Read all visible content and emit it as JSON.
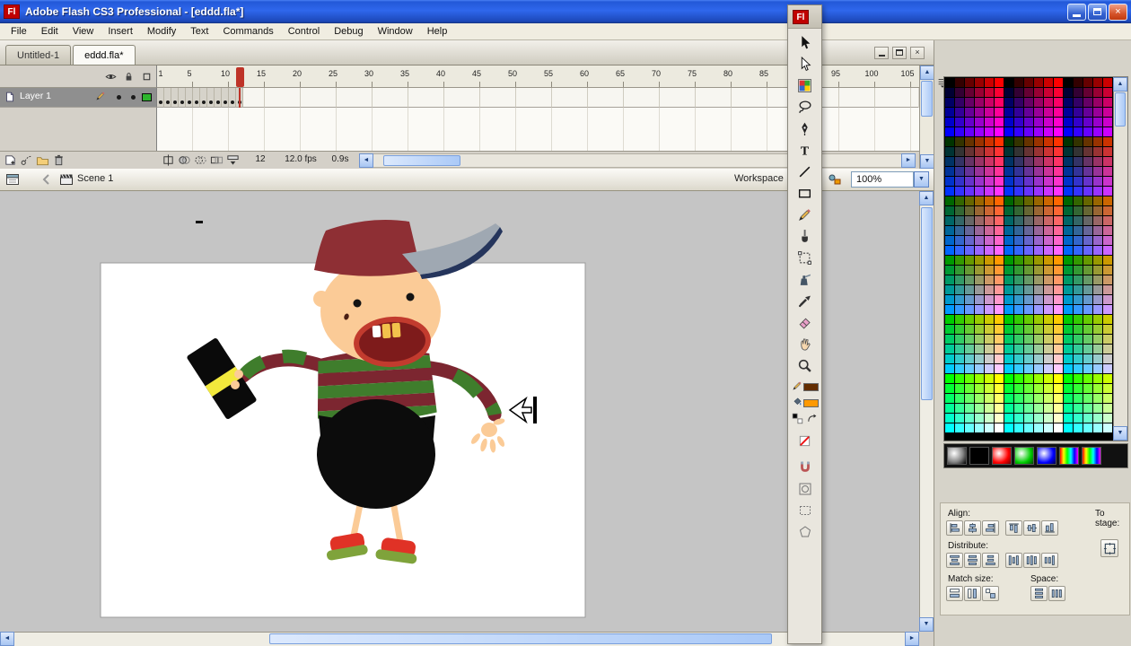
{
  "window": {
    "title": "Adobe Flash CS3 Professional - [eddd.fla*]",
    "app_icon_text": "Fl"
  },
  "menu_bar": {
    "items": [
      "File",
      "Edit",
      "View",
      "Insert",
      "Modify",
      "Text",
      "Commands",
      "Control",
      "Debug",
      "Window",
      "Help"
    ]
  },
  "document_tabs": [
    {
      "label": "Untitled-1",
      "active": false
    },
    {
      "label": "eddd.fla*",
      "active": true
    }
  ],
  "timeline": {
    "ruler_labels": [
      "1",
      "5",
      "10",
      "15",
      "20",
      "25",
      "30",
      "35",
      "40",
      "45",
      "50",
      "55",
      "60",
      "65",
      "70",
      "75",
      "80",
      "85",
      "90",
      "95",
      "100",
      "105"
    ],
    "frame_width": 8,
    "total_frames": 106,
    "playhead_frame": 12,
    "playhead_color": "#BE3328",
    "layer": {
      "name": "Layer 1",
      "keyframe_count": 12,
      "outline_color": "#2DB52D"
    },
    "header_icons": [
      "show-hide",
      "lock",
      "outline"
    ],
    "layer_buttons": [
      "insert-layer",
      "add-motion-guide",
      "insert-folder",
      "delete-layer"
    ],
    "onion_buttons": [
      "center-frame",
      "onion-skin",
      "onion-outlines",
      "edit-multiple-frames",
      "modify-onion-markers"
    ],
    "status": {
      "current_frame": "12",
      "frame_rate": "12.0 fps",
      "elapsed_time": "0.9s"
    }
  },
  "edit_bar": {
    "scene_label": "Scene 1",
    "workspace_label": "Workspace",
    "zoom_value": "100%"
  },
  "tools_panel": {
    "icon_text": "Fl",
    "tools": [
      "selection",
      "subselection",
      "gradient-transform",
      "lasso",
      "pen",
      "text",
      "line",
      "rectangle",
      "pencil",
      "brush",
      "free-transform",
      "ink-bottle",
      "eyedropper",
      "eraser",
      "hand",
      "zoom"
    ],
    "stroke_color": "#632D00",
    "fill_color": "#FF9900",
    "mini_buttons": [
      "black-white",
      "swap-colors"
    ],
    "no_color_button": "no-color",
    "option_buttons": [
      "magnet",
      "object-drawing",
      "dashed-rect",
      "poly-mode"
    ]
  },
  "swatches_panel": {
    "columns": 17,
    "rows": 36,
    "levels": [
      0,
      51,
      102,
      153,
      204,
      255
    ]
  },
  "preset_swatches": [
    "radial-gray",
    "solid-black",
    "solid-red",
    "solid-green",
    "solid-blue",
    "rainbow-a",
    "rainbow-b"
  ],
  "align_panel": {
    "labels": {
      "align": "Align:",
      "distribute": "Distribute:",
      "match": "Match size:",
      "space": "Space:",
      "to_stage": "To stage:"
    },
    "align_buttons": [
      "align-left",
      "align-h-center",
      "align-right",
      "align-top",
      "align-v-center",
      "align-bottom"
    ],
    "distribute_buttons": [
      "dist-top",
      "dist-v-center",
      "dist-bottom",
      "dist-left",
      "dist-h-center",
      "dist-right"
    ],
    "match_buttons": [
      "match-width",
      "match-height",
      "match-both"
    ],
    "space_buttons": [
      "space-v",
      "space-h"
    ],
    "to_stage_button": "to-stage"
  },
  "stage": {
    "canvas_color": "#FFFFFF",
    "pasteboard_color": "#C5C5C5",
    "character_colors": {
      "cap": "#8E2F34",
      "brim": "#9FA8B2",
      "brim_edge": "#25355C",
      "skin": "#FBCB97",
      "eye": "#141414",
      "mouth": "#7E1B1B",
      "lip": "#C23B2E",
      "tooth_gold": "#F2C24C",
      "tooth_white": "#FFFFFF",
      "stripe_red": "#7C2630",
      "stripe_green": "#3F7D2C",
      "body": "#0C0C0C",
      "prop": "#0A0A0A",
      "prop_band": "#F2E93C",
      "shoe_red": "#E03226",
      "shoe_sole": "#7FA33B"
    }
  }
}
